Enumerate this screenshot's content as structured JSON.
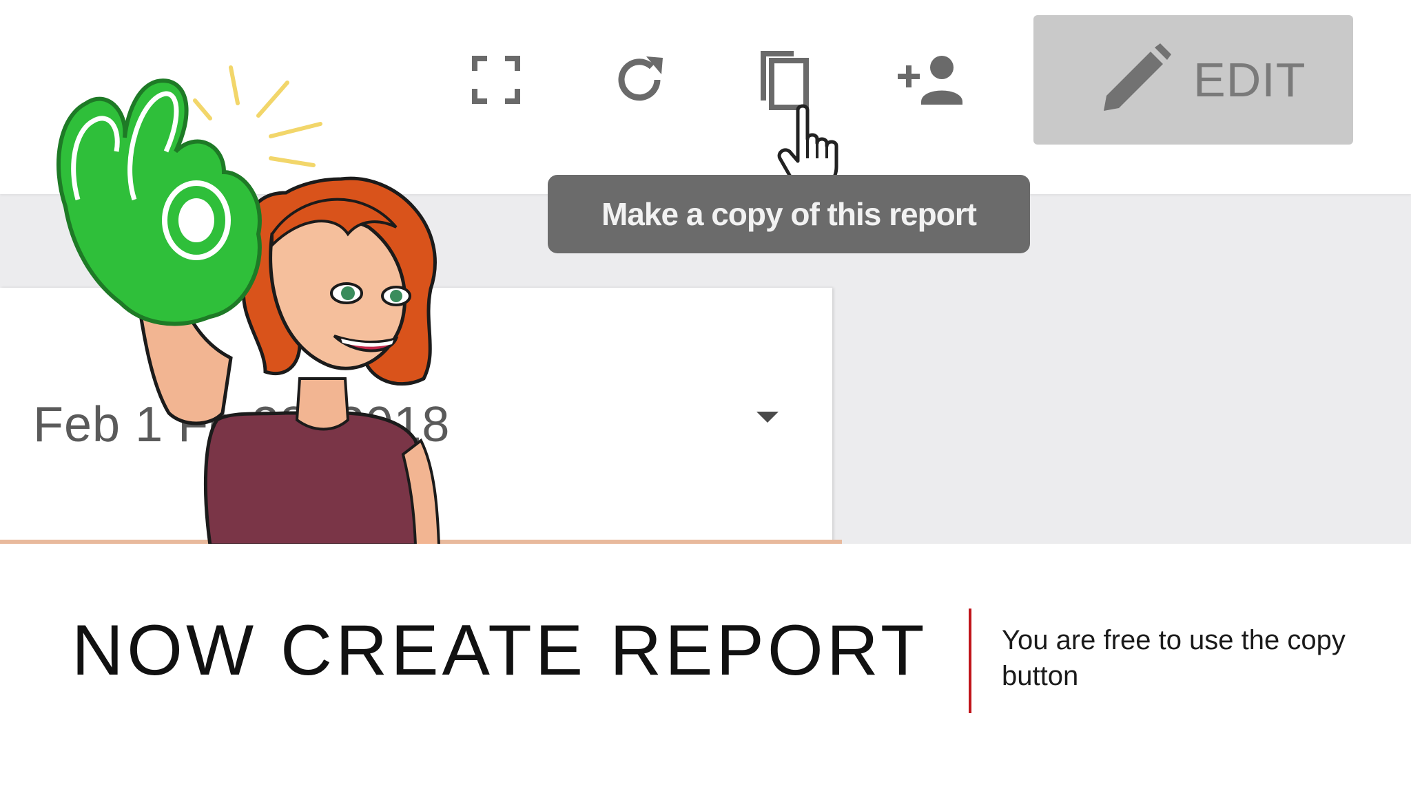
{
  "toolbar": {
    "buttons": [
      {
        "name": "fullscreen",
        "icon": "fullscreen-icon"
      },
      {
        "name": "refresh",
        "icon": "refresh-icon"
      },
      {
        "name": "copy",
        "icon": "copy-icon"
      },
      {
        "name": "share",
        "icon": "add-person-icon"
      }
    ],
    "edit_label": "EDIT",
    "edit_icon": "pencil-icon"
  },
  "tooltip": {
    "text": "Make a copy of this report"
  },
  "date_range": {
    "value_visible": "Feb 1    Fe      28, 2018",
    "dropdown_icon": "caret-down-icon"
  },
  "caption": {
    "title": "NOW CREATE REPORT",
    "subtitle": "You are free to use the copy button",
    "accent_color": "#c0151b"
  }
}
